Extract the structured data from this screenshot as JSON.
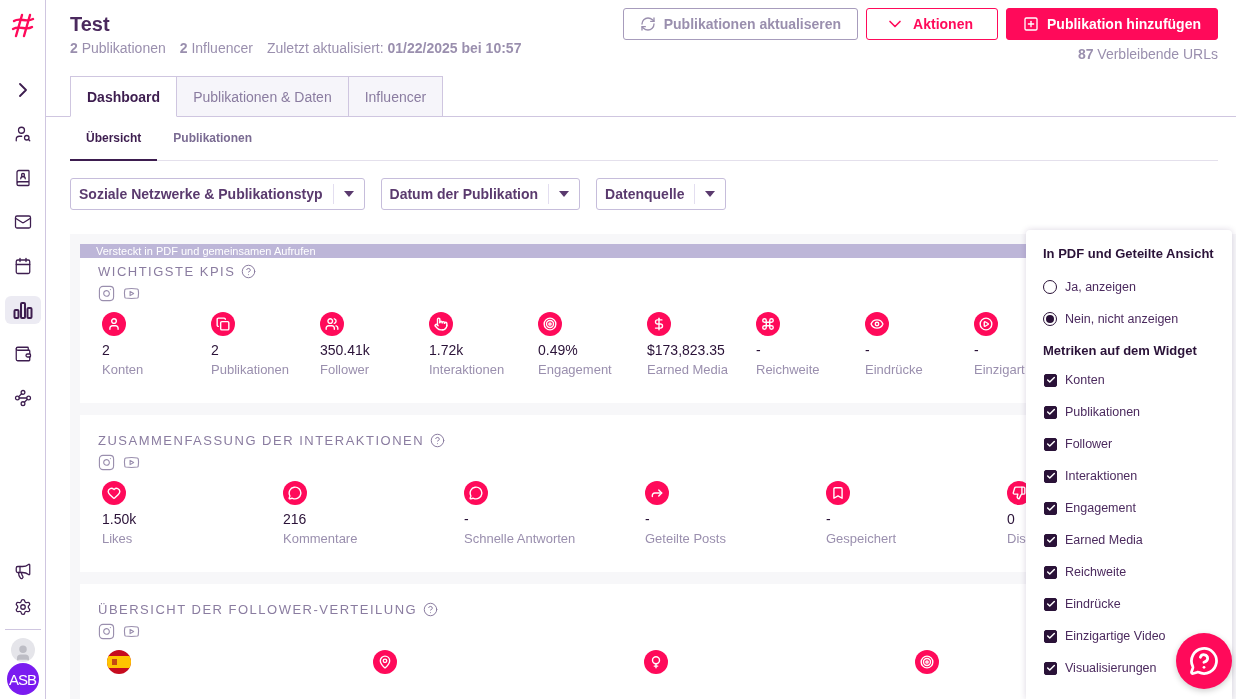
{
  "sidebar": {
    "items": [
      {
        "selected": false
      },
      {
        "selected": false
      },
      {
        "selected": false
      },
      {
        "selected": false
      },
      {
        "selected": false
      },
      {
        "selected": true
      },
      {
        "selected": false
      },
      {
        "selected": false
      }
    ],
    "bottom_items": [
      {
        "selected": false
      },
      {
        "selected": false
      }
    ],
    "avatar": "ASB"
  },
  "header": {
    "title": "Test",
    "stats": [
      "**2** Publikationen",
      "**2** Influencer",
      "Zuletzt aktualisiert: **01/22/2025 bei 10:57**"
    ]
  },
  "actions": [
    {
      "kind": "outline",
      "label": "Publikationen aktualiseren"
    },
    {
      "kind": "danger",
      "label": "Aktionen"
    },
    {
      "kind": "primary",
      "label": "Publikation hinzufügen"
    }
  ],
  "remaining": "**87** Verbleibende URLs",
  "tabs": [
    {
      "label": "Dashboard",
      "selected": true
    },
    {
      "label": "Publikationen & Daten",
      "selected": false
    },
    {
      "label": "Influencer",
      "selected": false
    }
  ],
  "subtabs": [
    {
      "label": "Übersicht",
      "selected": true
    },
    {
      "label": "Publikationen",
      "selected": false
    }
  ],
  "filters": [
    "Soziale Netzwerke & Publikationstyp",
    "Datum der Publikation",
    "Datenquelle"
  ],
  "banner": "Versteckt in PDF und gemeinsamen Aufrufen",
  "widgets": [
    {
      "kind": "kpis",
      "title": "WICHTIGSTE KPIS",
      "metrics": [
        {
          "value": "2",
          "label": "Konten"
        },
        {
          "value": "2",
          "label": "Publikationen"
        },
        {
          "value": "350.41k",
          "label": "Follower"
        },
        {
          "value": "1.72k",
          "label": "Interaktionen"
        },
        {
          "value": "0.49%",
          "label": "Engagement"
        },
        {
          "value": "$173,823.35",
          "label": "Earned Media"
        },
        {
          "value": "-",
          "label": "Reichweite"
        },
        {
          "value": "-",
          "label": "Eindrücke"
        },
        {
          "value": "-",
          "label": "Einzigart"
        }
      ]
    },
    {
      "kind": "interactions",
      "title": "ZUSAMMENFASSUNG DER INTERAKTIONEN",
      "metrics": [
        {
          "value": "1.50k",
          "label": "Likes"
        },
        {
          "value": "216",
          "label": "Kommentare"
        },
        {
          "value": "-",
          "label": "Schnelle Antworten"
        },
        {
          "value": "-",
          "label": "Geteilte Posts"
        },
        {
          "value": "-",
          "label": "Gespeichert"
        },
        {
          "value": "0",
          "label": "Dis"
        }
      ]
    },
    {
      "kind": "distribution",
      "title": "ÜBERSICHT DER FOLLOWER-VERTEILUNG"
    }
  ],
  "panel": {
    "title": "In PDF und Geteilte Ansicht",
    "radios": [
      {
        "label": "Ja, anzeigen",
        "selected": false
      },
      {
        "label": "Nein, nicht anzeigen",
        "selected": true
      }
    ],
    "metrics_title": "Metriken auf dem Widget",
    "checks": [
      {
        "label": "Konten",
        "checked": true
      },
      {
        "label": "Publikationen",
        "checked": true
      },
      {
        "label": "Follower",
        "checked": true
      },
      {
        "label": "Interaktionen",
        "checked": true
      },
      {
        "label": "Engagement",
        "checked": true
      },
      {
        "label": "Earned Media",
        "checked": true
      },
      {
        "label": "Reichweite",
        "checked": true
      },
      {
        "label": "Eindrücke",
        "checked": true
      },
      {
        "label": "Einzigartige Video",
        "checked": true
      },
      {
        "label": "Visualisierungen",
        "checked": true
      }
    ]
  }
}
